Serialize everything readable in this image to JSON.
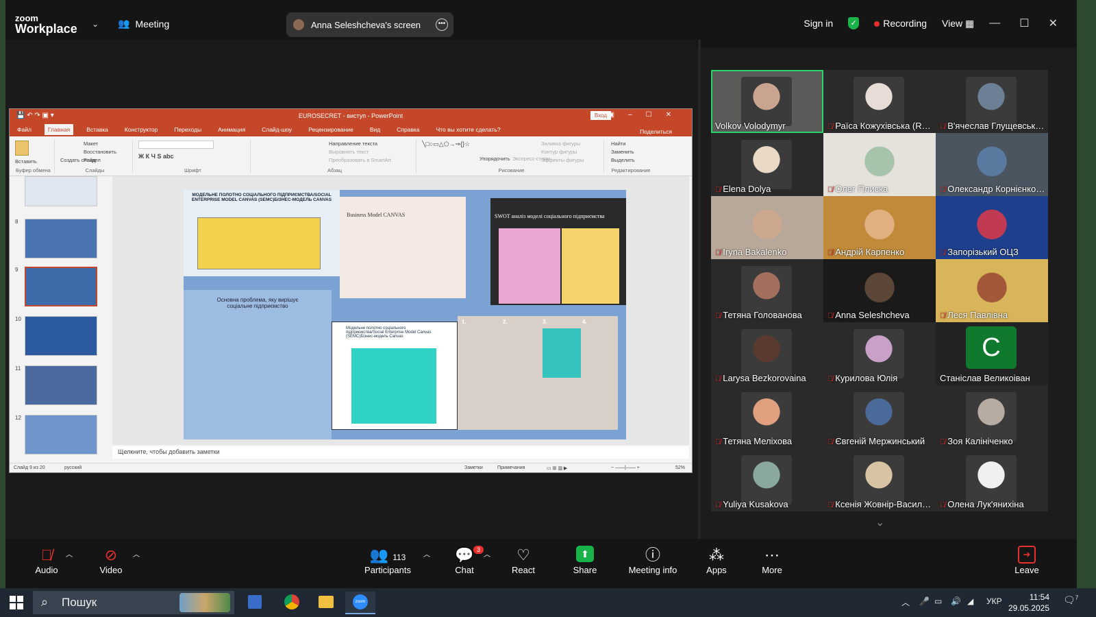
{
  "zoom": {
    "brand_line1": "zoom",
    "brand_line2": "Workplace",
    "meeting_label": "Meeting",
    "shared_screen_label": "Anna Seleshcheva's screen",
    "sign_in": "Sign in",
    "recording": "Recording",
    "view": "View"
  },
  "ppt": {
    "title": "EUROSECRET - виступ - PowerPoint",
    "login": "Вход",
    "tabs": [
      "Файл",
      "Главная",
      "Вставка",
      "Конструктор",
      "Переходы",
      "Анимация",
      "Слайд-шоу",
      "Рецензирование",
      "Вид",
      "Справка",
      "Что вы хотите сделать?"
    ],
    "share": "Поделиться",
    "ribbon": {
      "paste": "Вставить",
      "clipboard": "Буфер обмена",
      "new_slide": "Создать слайд",
      "layout": "Макет",
      "reset": "Восстановить",
      "section": "Раздел",
      "slides": "Слайды",
      "font": "Шрифт",
      "paragraph": "Абзац",
      "text_direction": "Направление текста",
      "align_text": "Выровнять текст",
      "smartart": "Преобразовать в SmartArt",
      "arrange": "Упорядочить",
      "quick_styles": "Экспресс-стили",
      "fill": "Заливка фигуры",
      "outline": "Контур фигуры",
      "effects": "Эффекты фигуры",
      "drawing": "Рисование",
      "find": "Найти",
      "replace": "Заменить",
      "select": "Выделить",
      "editing": "Редактирование"
    },
    "thumbnail_numbers": [
      "8",
      "9",
      "10",
      "11",
      "12"
    ],
    "slide_texts": {
      "panel1_title": "МОДЕЛЬНЕ ПОЛОТНО СОЦІАЛЬНОГО ПІДПРИЄМСТВА/SOCIAL ENTERPRISE MODEL CANVAS (SEMC)БІЗНЕС-МОДЕЛЬ CANVAS",
      "panel2_title": "Business Model CANVAS",
      "panel3_title": "SWOT аналіз моделі соціального підприємства",
      "panel4_title": "Основна проблема, яку вирішує соціальне підприємство",
      "panel5_title": "Модельне полотно соціального підприємства/Social Enterprise Model Canvas (SEMC)Бізнес-модель Canvas",
      "photo_labels": [
        "1.",
        "2.",
        "3.",
        "4."
      ]
    },
    "notes_placeholder": "Щелкните, чтобы добавить заметки",
    "status_slide": "Слайд 9 из 20",
    "status_lang": "русский",
    "status_notes": "Заметки",
    "status_comments": "Примечания",
    "zoom_level": "52%"
  },
  "participants": [
    {
      "name": "Volkov Volodymyr",
      "muted": false,
      "active": true,
      "bg": "#5a5a58",
      "face": "#c9a48e"
    },
    {
      "name": "Раїса Кожухівська (Rai...",
      "muted": true,
      "bg": "#2a2a2a",
      "face": "#e8ddd6"
    },
    {
      "name": "В'ячеслав Глущевськи...",
      "muted": true,
      "bg": "#2a2a2a",
      "face": "#6d7f95"
    },
    {
      "name": "Elena Dolya",
      "muted": true,
      "bg": "#2a2a2a",
      "face": "#e9d9c5"
    },
    {
      "name": "Олег Плиска",
      "muted": true,
      "bg": "#e5e2dc",
      "face": "#a7c3a9",
      "full": true
    },
    {
      "name": "Олександр Корнієнко ...",
      "muted": true,
      "bg": "#4a5560",
      "face": "#5a7aa0",
      "full": true
    },
    {
      "name": "Iryna Bakalenko",
      "muted": true,
      "bg": "#b8a89a",
      "face": "#cba88e",
      "full": true
    },
    {
      "name": "Андрій Карпенко",
      "muted": true,
      "bg": "#c08a3a",
      "face": "#e0b080",
      "full": true
    },
    {
      "name": "Запорізький ОЦЗ",
      "muted": true,
      "bg": "#1d3f8c",
      "face": "#c23a52",
      "full": true
    },
    {
      "name": "Тетяна Голованова",
      "muted": true,
      "bg": "#2a2a2a",
      "face": "#a3705e"
    },
    {
      "name": "Anna Seleshcheva",
      "muted": true,
      "bg": "#1a1a1a",
      "face": "#5b4638",
      "full": true
    },
    {
      "name": "Леся Павлівна",
      "muted": true,
      "bg": "#d8b45a",
      "face": "#a3583a",
      "full": true
    },
    {
      "name": "Larysa Bezkorovaina",
      "muted": true,
      "bg": "#2a2a2a",
      "face": "#5a3a30"
    },
    {
      "name": "Курилова Юлія",
      "muted": true,
      "bg": "#2a2a2a",
      "face": "#c8a0c8"
    },
    {
      "name": "Станіслав Великоіван",
      "muted": false,
      "letter": "C"
    },
    {
      "name": "Тетяна Меліхова",
      "muted": true,
      "bg": "#2a2a2a",
      "face": "#e0a080"
    },
    {
      "name": "Євгеній Мержинський",
      "muted": true,
      "bg": "#2a2a2a",
      "face": "#4a6a9a"
    },
    {
      "name": "Зоя Калініченко",
      "muted": true,
      "bg": "#2a2a2a",
      "face": "#b8aca2"
    },
    {
      "name": "Yuliya Kusakova",
      "muted": true,
      "bg": "#2a2a2a",
      "face": "#8aa8a0"
    },
    {
      "name": "Ксенія Жовнір-Василе...",
      "muted": true,
      "bg": "#2a2a2a",
      "face": "#d8c4a4"
    },
    {
      "name": "Олена Лук'янихіна",
      "muted": true,
      "bg": "#2a2a2a",
      "face": "#f0f0f0"
    }
  ],
  "toolbar": {
    "audio": "Audio",
    "video": "Video",
    "participants": "Participants",
    "participants_count": "113",
    "chat": "Chat",
    "chat_badge": "3",
    "react": "React",
    "share": "Share",
    "meeting_info": "Meeting info",
    "apps": "Apps",
    "more": "More",
    "leave": "Leave"
  },
  "taskbar": {
    "search": "Пошук",
    "lang": "УКР",
    "time": "11:54",
    "date": "29.05.2025",
    "notif_count": "7"
  },
  "colors": {
    "ppt_accent": "#c4472a",
    "active_speaker": "#2ad36a",
    "share_green": "#19b34a",
    "mute_red": "#e8312f"
  }
}
